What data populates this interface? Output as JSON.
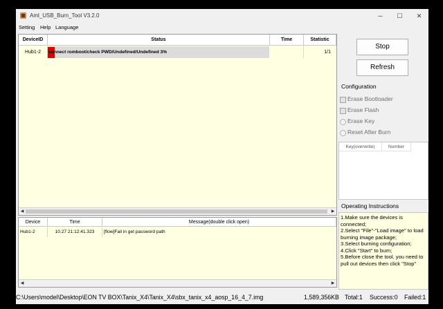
{
  "window": {
    "title": "Aml_USB_Burn_Tool V3.2.0",
    "minimize": "─",
    "maximize": "☐",
    "close": "✕"
  },
  "menu": [
    "Setting",
    "Help",
    "Language"
  ],
  "device_table": {
    "columns": [
      "DeviceID",
      "Status",
      "Time",
      "Statistic"
    ],
    "row": {
      "device_id": "Hub1-2",
      "status": "connect romboot/check PWD/Undefined/Undefined 3%",
      "time": "",
      "statistic": "1/1"
    },
    "progress_percent": 3,
    "scroll_left": "◀",
    "scroll_right": "▶"
  },
  "log_table": {
    "columns": [
      "Device",
      "Time",
      "Message(double click open)"
    ],
    "row": {
      "device": "Hub1-2",
      "time": "10.27 21:12:41.323",
      "message": "[flow]Fail in get password path"
    }
  },
  "buttons": {
    "stop": "Stop",
    "refresh": "Refresh"
  },
  "configuration": {
    "title": "Configuration",
    "erase_bootloader": "Erase Bootloader",
    "erase_flash": "Erase Flash",
    "erase_key": "Erase Key",
    "reset_after_burn": "Reset After Burn"
  },
  "key_table": {
    "columns": [
      "Key(overwrite)",
      "Number"
    ]
  },
  "instructions": {
    "title": "Operating Instructions",
    "text": "1.Make sure the devices is connected;\n2.Select \"File\"-\"Load image\" to load burning image package;\n3.Select burning configuration;\n4.Click \"Start\" to burn;\n5.Before close the tool, you need to pull out devices then click \"Stop\""
  },
  "status_bar": {
    "path": "C:\\Users\\model\\Desktop\\EON TV BOX\\Tanix_X4\\Tanix_X4\\sbx_tanix_x4_aosp_16_4_7.img",
    "size": "1,589,356KB",
    "total": "Total:1",
    "success": "Success:0",
    "failed": "Failed:1"
  },
  "colors": {
    "progress": "#e00000",
    "grid_bg": "#ffffe1"
  }
}
